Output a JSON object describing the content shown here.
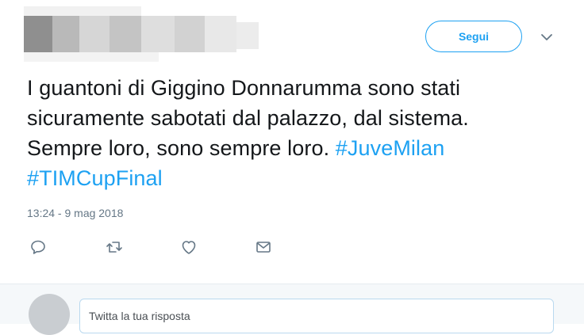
{
  "author": {
    "name_redacted": ""
  },
  "follow_button": {
    "label": "Segui"
  },
  "menu": {
    "icon": "chevron-down-icon"
  },
  "tweet": {
    "lines": [
      "I guantoni di Giggino Donnarumma sono stati",
      "sicuramente sabotati dal palazzo, dal sistema.",
      "Sempre loro, sono sempre loro. "
    ],
    "hashtags": [
      "#JuveMilan",
      "#TIMCupFinal"
    ],
    "timestamp": "13:24 - 9 mag 2018"
  },
  "actions": [
    {
      "name": "reply-icon"
    },
    {
      "name": "retweet-icon"
    },
    {
      "name": "like-icon"
    },
    {
      "name": "direct-message-icon"
    }
  ],
  "reply_box": {
    "placeholder": "Twitta la tua risposta"
  },
  "colors": {
    "accent": "#1da1f2",
    "text": "#14171a",
    "secondary_text": "#657786",
    "reply_bar_bg": "#f5f8fa"
  }
}
